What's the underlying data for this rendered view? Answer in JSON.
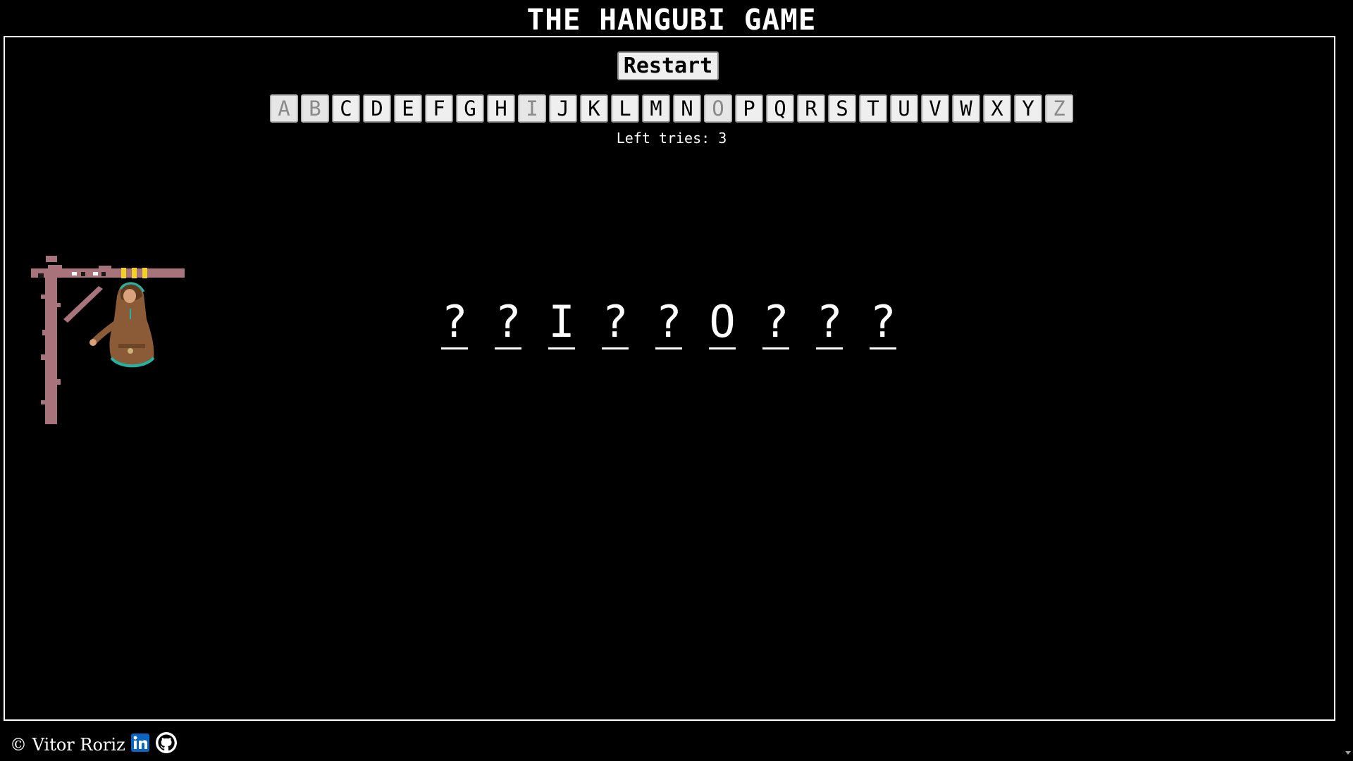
{
  "title": "THE HANGUBI GAME",
  "restart_label": "Restart",
  "alphabet": [
    {
      "letter": "A",
      "used": true
    },
    {
      "letter": "B",
      "used": true
    },
    {
      "letter": "C",
      "used": false
    },
    {
      "letter": "D",
      "used": false
    },
    {
      "letter": "E",
      "used": false
    },
    {
      "letter": "F",
      "used": false
    },
    {
      "letter": "G",
      "used": false
    },
    {
      "letter": "H",
      "used": false
    },
    {
      "letter": "I",
      "used": true
    },
    {
      "letter": "J",
      "used": false
    },
    {
      "letter": "K",
      "used": false
    },
    {
      "letter": "L",
      "used": false
    },
    {
      "letter": "M",
      "used": false
    },
    {
      "letter": "N",
      "used": false
    },
    {
      "letter": "O",
      "used": true
    },
    {
      "letter": "P",
      "used": false
    },
    {
      "letter": "Q",
      "used": false
    },
    {
      "letter": "R",
      "used": false
    },
    {
      "letter": "S",
      "used": false
    },
    {
      "letter": "T",
      "used": false
    },
    {
      "letter": "U",
      "used": false
    },
    {
      "letter": "V",
      "used": false
    },
    {
      "letter": "W",
      "used": false
    },
    {
      "letter": "X",
      "used": false
    },
    {
      "letter": "Y",
      "used": false
    },
    {
      "letter": "Z",
      "used": true
    }
  ],
  "tries_text": "Left tries: 3",
  "word_slots": [
    "?",
    "?",
    "I",
    "?",
    "?",
    "O",
    "?",
    "?",
    "?"
  ],
  "footer": {
    "author": "© Vitor Roriz",
    "links": [
      "linkedin-icon",
      "github-icon"
    ]
  },
  "colors": {
    "background": "#000000",
    "foreground": "#ffffff",
    "gallows": "#a8737a",
    "rope": "#f2d024",
    "character_robe": "#8b5a36",
    "character_trim": "#1fb5a5",
    "linkedin": "#0a66c2"
  }
}
